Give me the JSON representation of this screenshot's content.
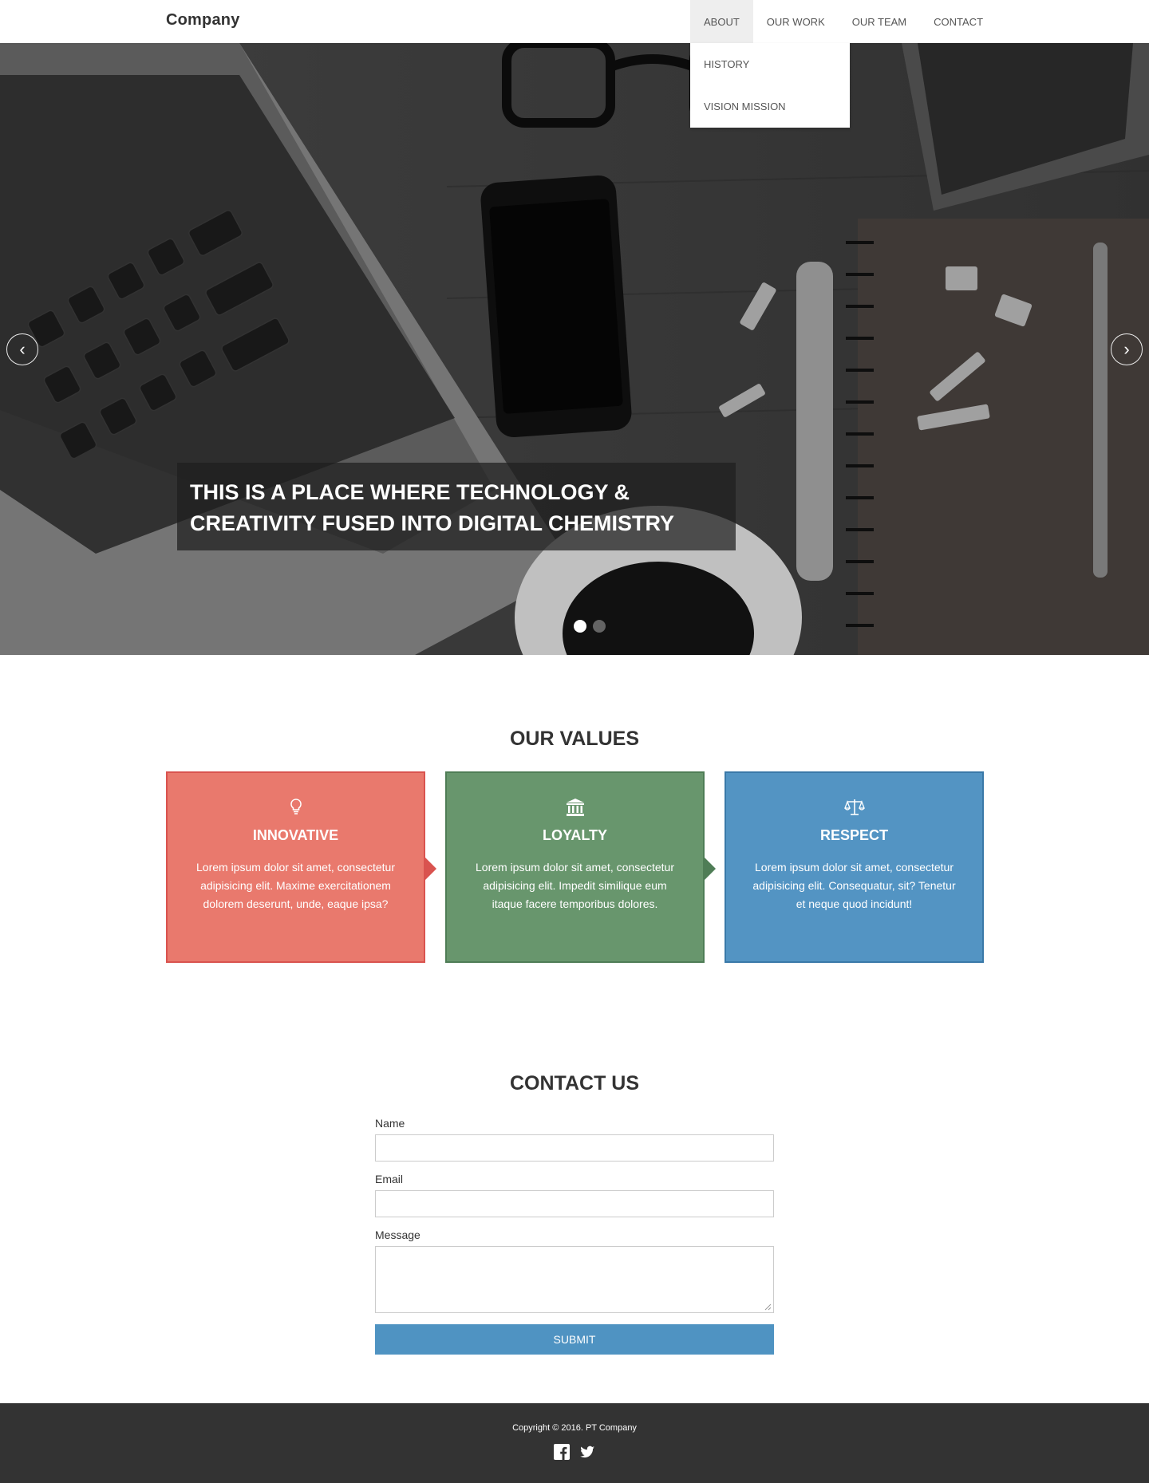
{
  "brand": "Company",
  "nav": {
    "items": [
      {
        "label": "ABOUT"
      },
      {
        "label": "OUR WORK"
      },
      {
        "label": "OUR TEAM"
      },
      {
        "label": "CONTACT"
      }
    ],
    "dropdown": [
      {
        "label": "HISTORY"
      },
      {
        "label": "VISION MISSION"
      }
    ]
  },
  "hero": {
    "caption": "THIS IS A PLACE WHERE TECHNOLOGY & CREATIVITY FUSED INTO DIGITAL CHEMISTRY",
    "prev_icon": "chevron-left-icon",
    "next_icon": "chevron-right-icon",
    "slides": 2,
    "active_slide": 1
  },
  "values": {
    "title": "OUR VALUES",
    "cards": [
      {
        "icon": "lightbulb-icon",
        "title": "INNOVATIVE",
        "text": "Lorem ipsum dolor sit amet, consectetur adipisicing elit. Maxime exercitationem dolorem deserunt, unde, eaque ipsa?",
        "color": "#e9796d",
        "border": "#d9534f"
      },
      {
        "icon": "bank-icon",
        "title": "LOYALTY",
        "text": "Lorem ipsum dolor sit amet, consectetur adipisicing elit. Impedit similique eum itaque facere temporibus dolores.",
        "color": "#68966d",
        "border": "#4f7d56"
      },
      {
        "icon": "balance-scale-icon",
        "title": "RESPECT",
        "text": "Lorem ipsum dolor sit amet, consectetur adipisicing elit. Consequatur, sit? Tenetur et neque quod incidunt!",
        "color": "#5394c3",
        "border": "#3a79a8"
      }
    ]
  },
  "contact": {
    "title": "CONTACT US",
    "name_label": "Name",
    "email_label": "Email",
    "message_label": "Message",
    "submit_label": "SUBMIT"
  },
  "footer": {
    "copyright": "Copyright © 2016. PT Company",
    "social": [
      "facebook-icon",
      "twitter-icon"
    ]
  }
}
